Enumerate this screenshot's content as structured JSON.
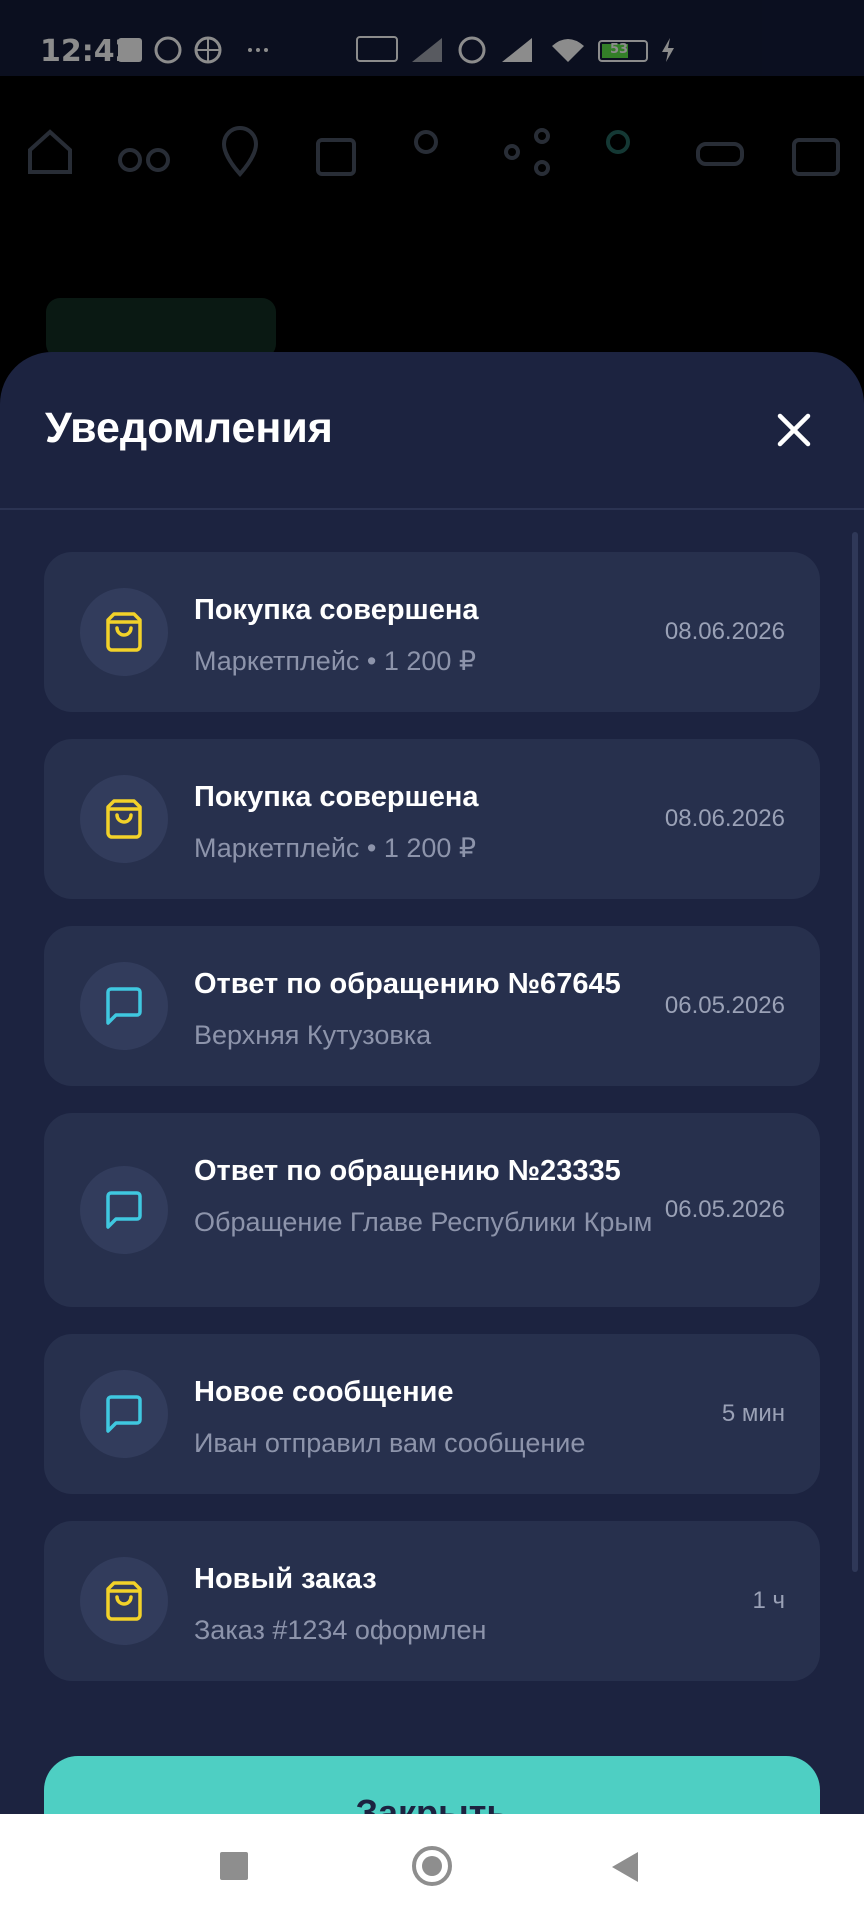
{
  "status_bar": {
    "time": "12:42",
    "battery": "53"
  },
  "sheet": {
    "title": "Уведомления",
    "close_label": "Закрыть"
  },
  "notifications": [
    {
      "icon": "shopping-bag-icon",
      "title": "Покупка совершена",
      "subtitle": "Маркетплейс • 1 200 ₽",
      "date": "08.06.2026"
    },
    {
      "icon": "shopping-bag-icon",
      "title": "Покупка совершена",
      "subtitle": "Маркетплейс • 1 200 ₽",
      "date": "08.06.2026"
    },
    {
      "icon": "chat-icon",
      "title": "Ответ по обращению №67645",
      "subtitle": "Верхняя Кутузовка",
      "date": "06.05.2026"
    },
    {
      "icon": "chat-icon",
      "title": "Ответ по обращению №23335",
      "subtitle": "Обращение Главе Республики Крым",
      "date": "06.05.2026"
    },
    {
      "icon": "chat-icon",
      "title": "Новое сообщение",
      "subtitle": "Иван отправил вам сообщение",
      "date": "5 мин"
    },
    {
      "icon": "shopping-bag-icon",
      "title": "Новый заказ",
      "subtitle": "Заказ #1234 оформлен",
      "date": "1 ч"
    }
  ],
  "colors": {
    "sheet_bg": "#1c2340",
    "card_bg": "#27304d",
    "bag_icon": "#f2d229",
    "chat_icon": "#3fc8e0",
    "accent_button": "#4ecfc3"
  }
}
